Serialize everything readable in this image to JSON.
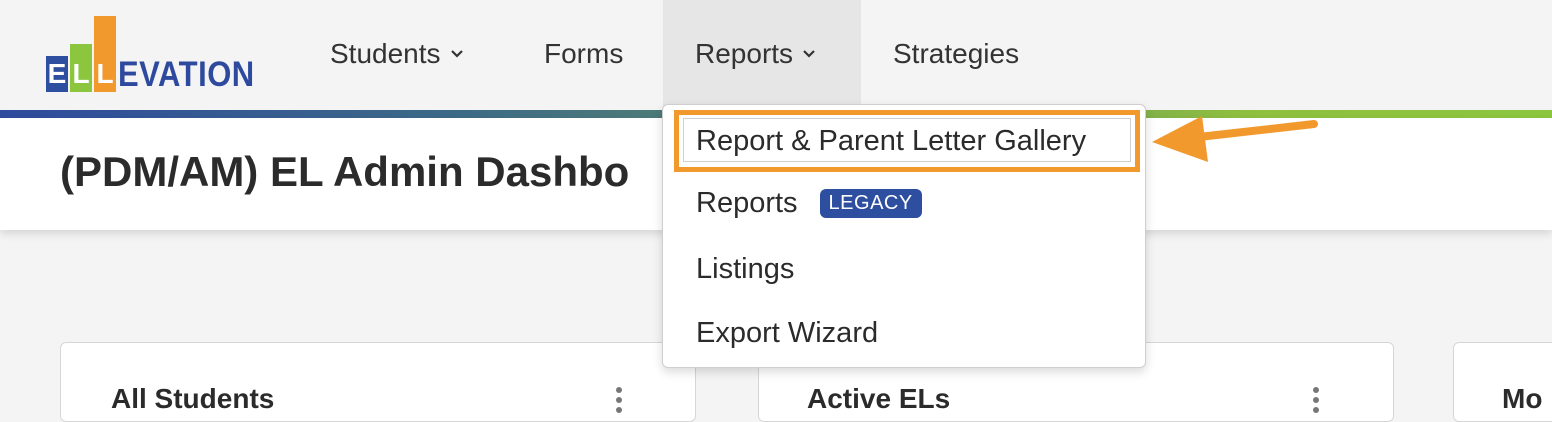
{
  "logo": {
    "letters": [
      "E",
      "L",
      "L"
    ],
    "rest": "EVATION",
    "colors": {
      "e_block": "#2e4fa0",
      "l1_block": "#8cc63f",
      "l2_block": "#f2992e",
      "text": "#2e4a9e"
    }
  },
  "nav": {
    "items": [
      {
        "label": "Students",
        "has_chevron": true
      },
      {
        "label": "Forms",
        "has_chevron": false
      },
      {
        "label": "Reports",
        "has_chevron": true,
        "active": true
      },
      {
        "label": "Strategies",
        "has_chevron": false
      }
    ]
  },
  "page": {
    "title": "(PDM/AM) EL Admin Dashbo"
  },
  "dropdown": {
    "items": [
      {
        "label": "Report & Parent Letter Gallery",
        "highlighted": true
      },
      {
        "label": "Reports",
        "badge": "LEGACY"
      },
      {
        "label": "Listings"
      },
      {
        "label": "Export Wizard"
      }
    ]
  },
  "cards": [
    {
      "title": "All Students"
    },
    {
      "title": "Active ELs"
    },
    {
      "title": "Mo"
    }
  ],
  "annotation": {
    "highlight_color": "#f2992e",
    "arrow_icon": "arrow-left-icon"
  }
}
